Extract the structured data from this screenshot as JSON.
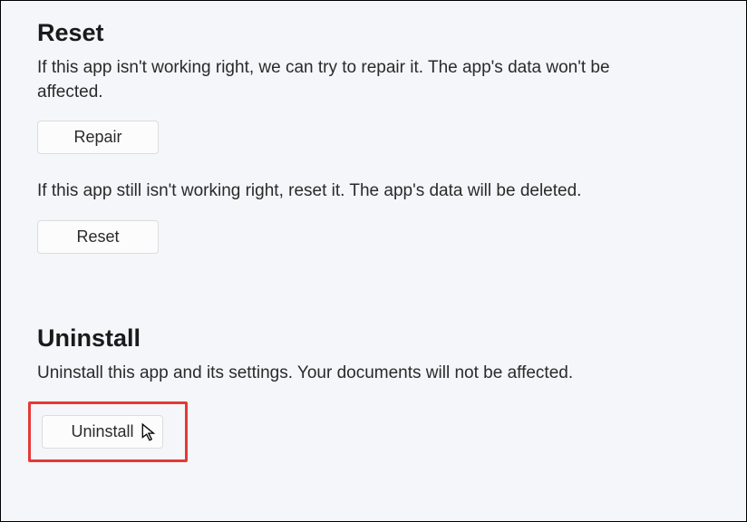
{
  "reset_section": {
    "heading": "Reset",
    "repair_description": "If this app isn't working right, we can try to repair it. The app's data won't be affected.",
    "repair_button_label": "Repair",
    "reset_description": "If this app still isn't working right, reset it. The app's data will be deleted.",
    "reset_button_label": "Reset"
  },
  "uninstall_section": {
    "heading": "Uninstall",
    "description": "Uninstall this app and its settings. Your documents will not be affected.",
    "uninstall_button_label": "Uninstall"
  }
}
